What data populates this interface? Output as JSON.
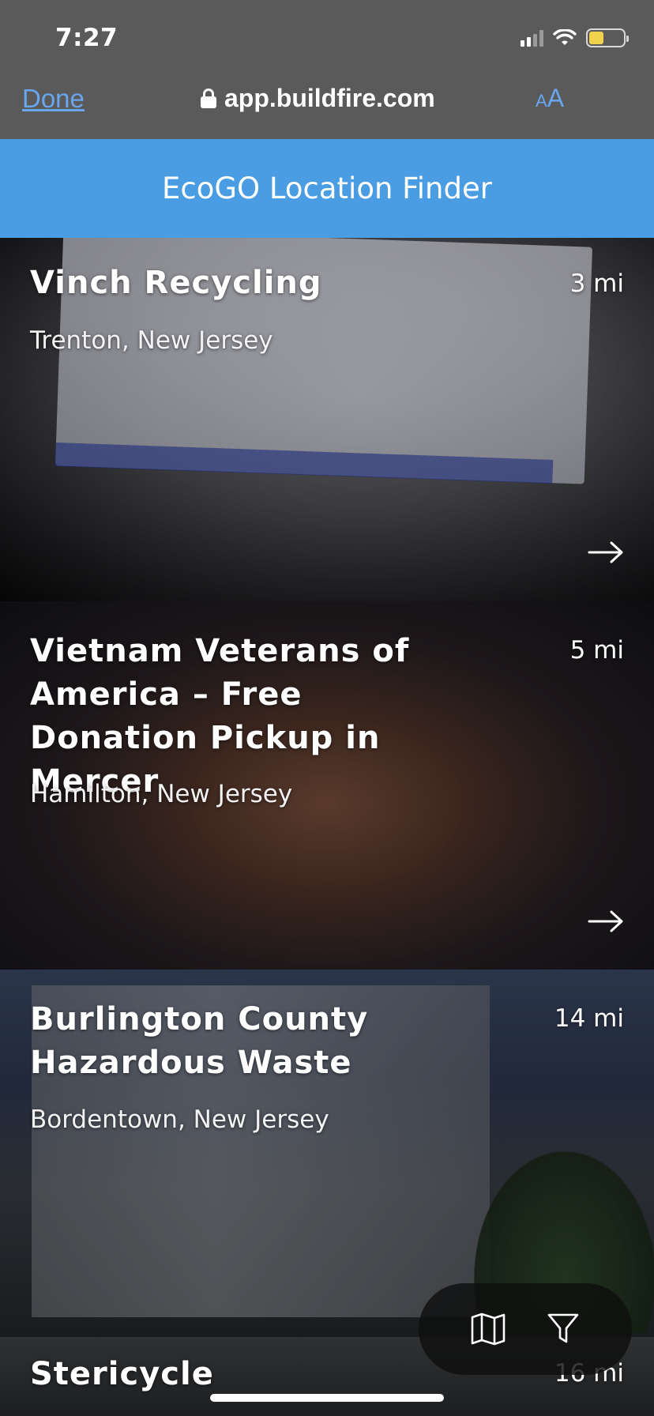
{
  "status_bar": {
    "time": "7:27",
    "battery_level": 0.44,
    "battery_color": "#f2d14c"
  },
  "browser": {
    "done_label": "Done",
    "url": "app.buildfire.com",
    "text_size_small": "A",
    "text_size_big": "A",
    "accent_color": "#6aa6ee"
  },
  "app": {
    "title": "EcoGO Location Finder",
    "header_color": "#4a9de3"
  },
  "locations": [
    {
      "name": "Vinch Recycling",
      "city": "Trenton, New Jersey",
      "distance": "3 mi"
    },
    {
      "name": "Vietnam Veterans of America – Free Donation Pickup in Mercer",
      "city": "Hamilton, New Jersey",
      "distance": "5 mi"
    },
    {
      "name": "Burlington County Hazardous Waste",
      "city": "Bordentown, New Jersey",
      "distance": "14 mi"
    },
    {
      "name": "Stericycle",
      "city": "",
      "distance": "16 mi"
    }
  ],
  "actions": [
    {
      "icon": "map-icon"
    },
    {
      "icon": "filter-icon"
    }
  ]
}
